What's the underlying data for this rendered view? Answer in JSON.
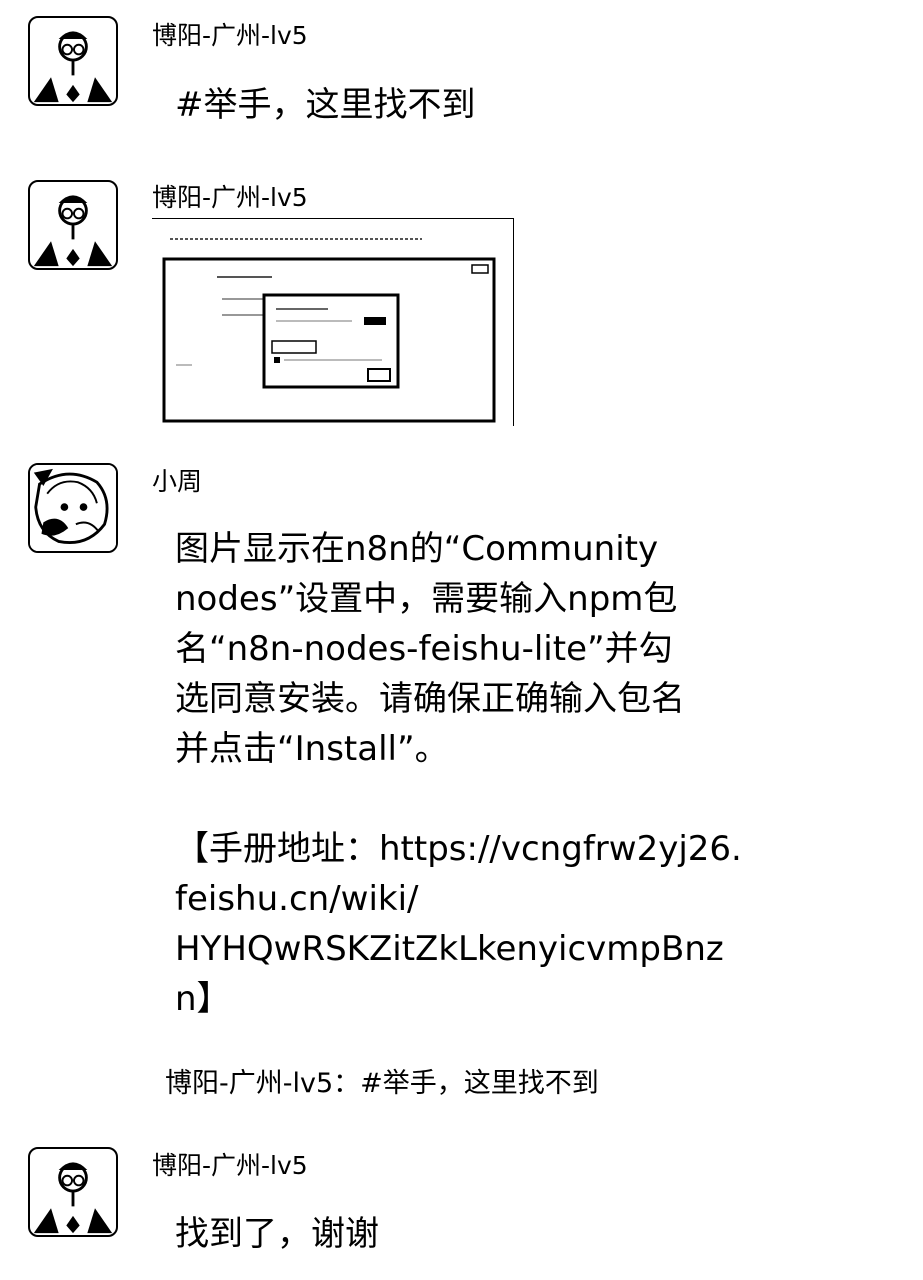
{
  "messages": [
    {
      "sender": "博阳-广州-lv5",
      "text": "#举手，这里找不到"
    },
    {
      "sender": "博阳-广州-lv5",
      "attachment_icon": "screenshot-image"
    },
    {
      "sender": "小周",
      "paragraphs": [
        "图片显示在n8n的“Community\nnodes”设置中，需要输入npm包\n名“n8n-nodes-feishu-lite”并勾\n选同意安装。请确保正确输入包名\n并点击“Install”。",
        "【手册地址：https://vcngfrw2yj26.\nfeishu.cn/wiki/\nHYHQwRSKZitZkLkenyicvmpBnz\nn】"
      ]
    },
    {
      "quote": "博阳-广州-lv5：#举手，这里找不到"
    },
    {
      "sender": "博阳-广州-lv5",
      "text": "找到了，谢谢"
    }
  ]
}
